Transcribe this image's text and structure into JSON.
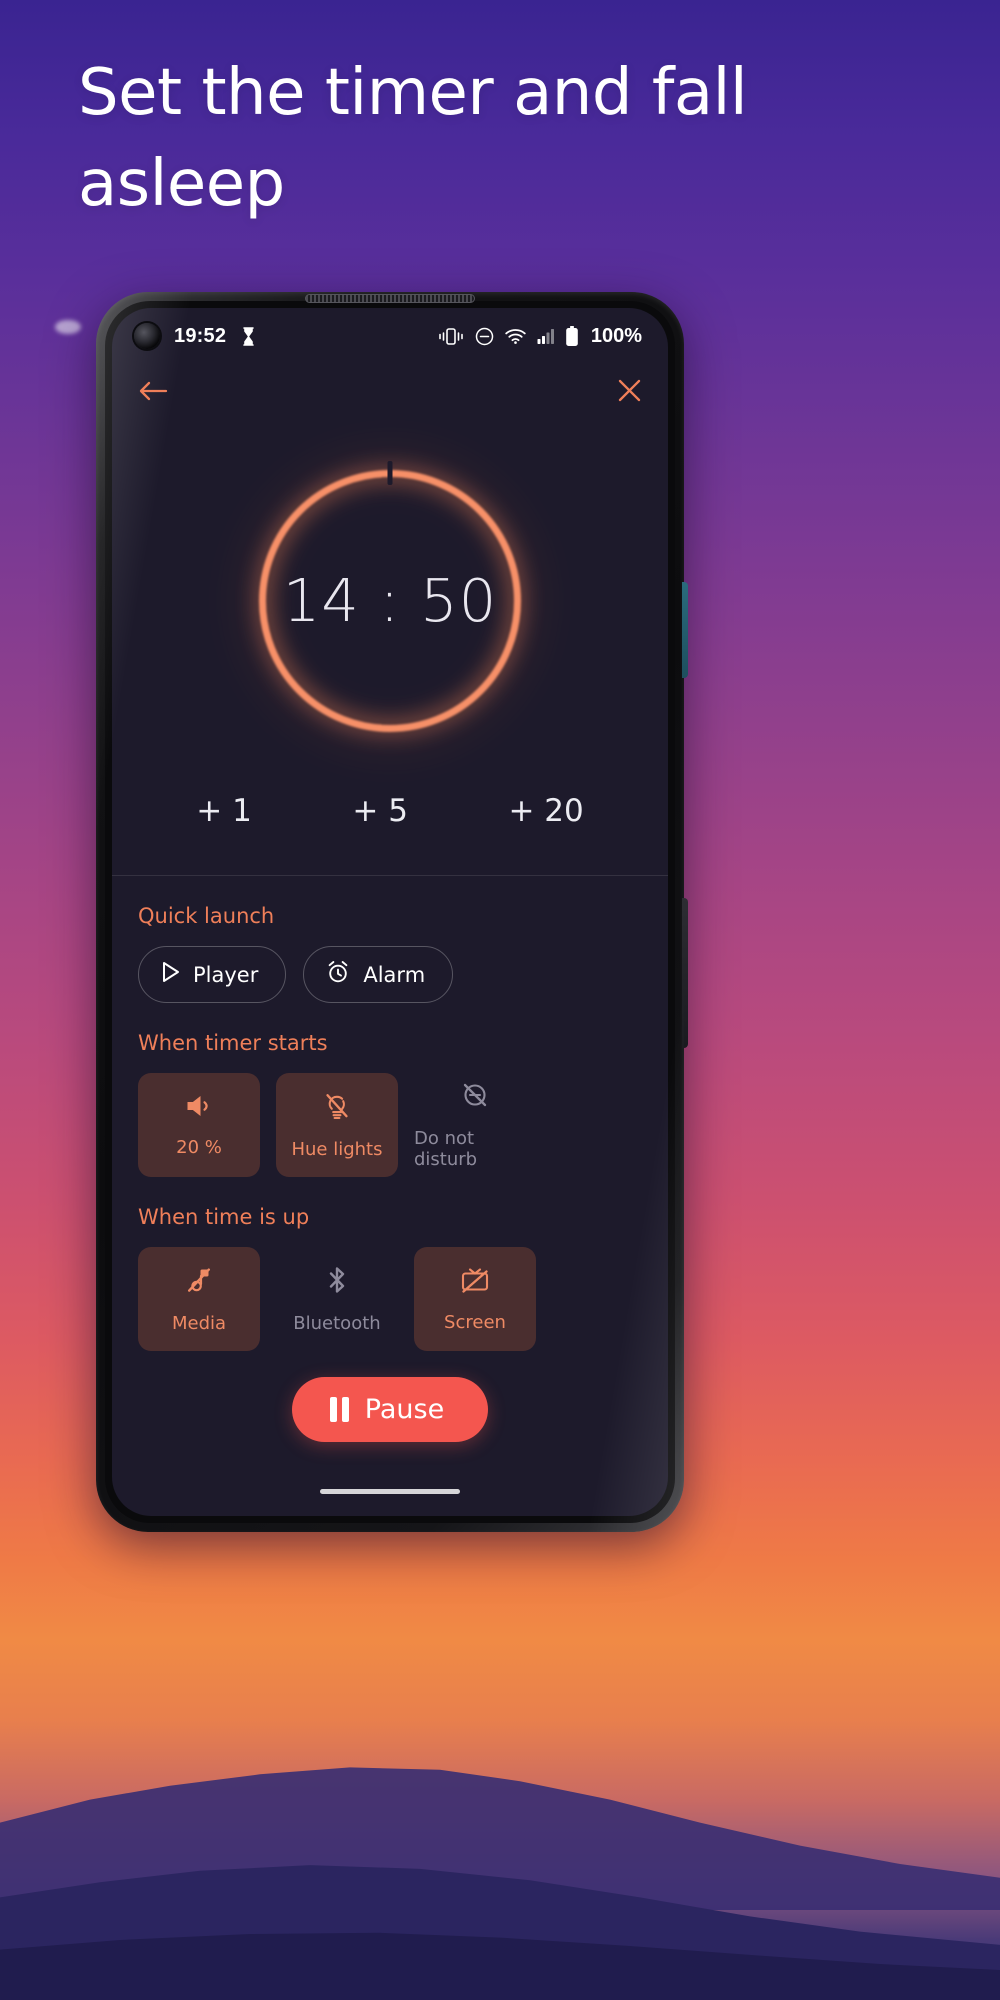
{
  "headline": "Set the timer and fall asleep",
  "colors": {
    "accent": "#ef7f59",
    "ring": "#f79068",
    "tile_active_bg": "#4a2e2f",
    "tile_active_fg": "#ef8a64",
    "tile_inactive_fg": "#8e8b9c",
    "pause_bg": "#f4564f",
    "screen_bg": "#1d1a2b"
  },
  "statusbar": {
    "time": "19:52",
    "battery_percent": "100%",
    "icons": [
      "hourglass-icon",
      "vibrate-icon",
      "do-not-disturb-icon",
      "wifi-icon",
      "cellular-signal-icon",
      "battery-icon"
    ]
  },
  "appbar": {
    "back_icon": "arrow-left-icon",
    "close_icon": "close-icon"
  },
  "timer": {
    "display": "14 : 50",
    "minutes": "14",
    "seconds": "50",
    "separator": ":",
    "progress_gap_at_top": true
  },
  "add_buttons": [
    {
      "label": "+ 1",
      "name": "add-1-minute-button"
    },
    {
      "label": "+ 5",
      "name": "add-5-minutes-button"
    },
    {
      "label": "+ 20",
      "name": "add-20-minutes-button"
    }
  ],
  "quick_launch": {
    "title": "Quick launch",
    "chips": [
      {
        "label": "Player",
        "icon": "play-icon"
      },
      {
        "label": "Alarm",
        "icon": "alarm-clock-icon"
      }
    ]
  },
  "when_timer_starts": {
    "title": "When timer starts",
    "tiles": [
      {
        "label": "20 %",
        "icon": "volume-up-icon",
        "active": true
      },
      {
        "label": "Hue lights",
        "icon": "lightbulb-off-icon",
        "active": true
      },
      {
        "label": "Do not disturb",
        "icon": "do-not-disturb-off-icon",
        "active": false
      }
    ]
  },
  "when_time_is_up": {
    "title": "When time is up",
    "tiles": [
      {
        "label": "Media",
        "icon": "music-off-icon",
        "active": true
      },
      {
        "label": "Bluetooth",
        "icon": "bluetooth-icon",
        "active": false
      },
      {
        "label": "Screen",
        "icon": "screen-off-icon",
        "active": true
      }
    ]
  },
  "pause": {
    "label": "Pause",
    "icon": "pause-icon"
  }
}
